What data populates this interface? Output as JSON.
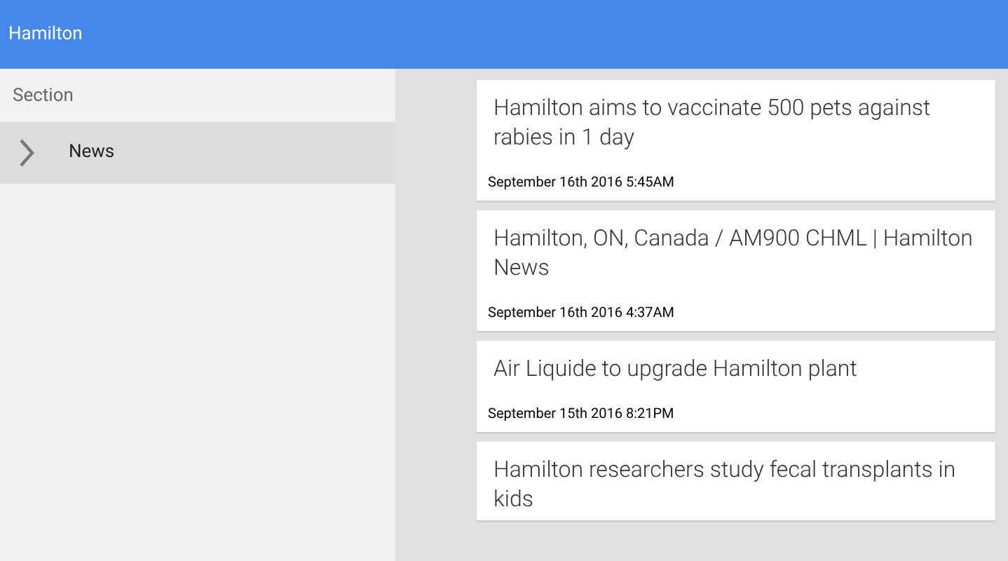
{
  "app_bar": {
    "title": "Hamilton"
  },
  "sidebar": {
    "header": "Section",
    "items": [
      {
        "label": "News",
        "selected": true
      }
    ]
  },
  "articles": [
    {
      "title": "Hamilton aims to vaccinate 500 pets against rabies in 1 day",
      "date": "September 16th 2016 5:45AM"
    },
    {
      "title": "Hamilton, ON, Canada / AM900 CHML | Hamilton News",
      "date": "September 16th 2016 4:37AM"
    },
    {
      "title": "Air Liquide to upgrade Hamilton plant",
      "date": "September 15th 2016 8:21PM"
    },
    {
      "title": "Hamilton researchers study fecal transplants in kids"
    }
  ]
}
